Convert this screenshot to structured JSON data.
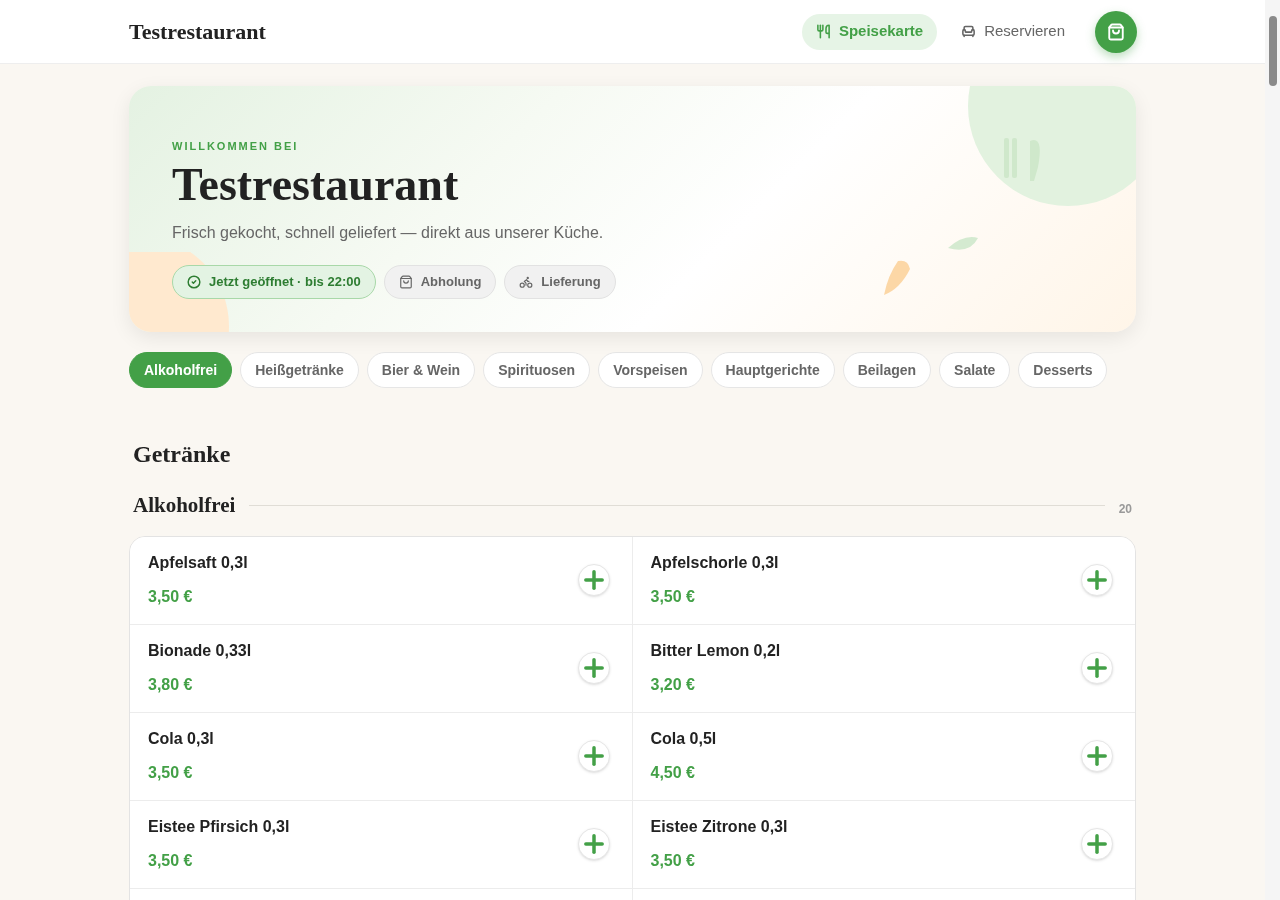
{
  "header": {
    "brand": "Testrestaurant",
    "nav": [
      {
        "label": "Speisekarte",
        "kind": "menu",
        "selected": true
      },
      {
        "label": "Reservieren",
        "kind": "reserve",
        "selected": false
      }
    ]
  },
  "hero": {
    "eyebrow": "WILLKOMMEN BEI",
    "title": "Testrestaurant",
    "subtitle": "Frisch gekocht, schnell geliefert — direkt aus unserer Küche.",
    "badges": [
      {
        "kind": "status",
        "label": "Jetzt geöffnet · bis 22:00"
      },
      {
        "kind": "pickup",
        "label": "Abholung"
      },
      {
        "kind": "delivery",
        "label": "Lieferung"
      }
    ]
  },
  "categories": [
    {
      "label": "Alkoholfrei",
      "selected": true
    },
    {
      "label": "Heißgetränke",
      "selected": false
    },
    {
      "label": "Bier & Wein",
      "selected": false
    },
    {
      "label": "Spirituosen",
      "selected": false
    },
    {
      "label": "Vorspeisen",
      "selected": false
    },
    {
      "label": "Hauptgerichte",
      "selected": false
    },
    {
      "label": "Beilagen",
      "selected": false
    },
    {
      "label": "Salate",
      "selected": false
    },
    {
      "label": "Desserts",
      "selected": false
    }
  ],
  "section": {
    "title": "Getränke",
    "subsection": "Alkoholfrei",
    "count": "20"
  },
  "items": [
    {
      "name": "Apfelsaft 0,3l",
      "price": "3,50 €"
    },
    {
      "name": "Apfelschorle 0,3l",
      "price": "3,50 €"
    },
    {
      "name": "Bionade 0,33l",
      "price": "3,80 €"
    },
    {
      "name": "Bitter Lemon 0,2l",
      "price": "3,20 €"
    },
    {
      "name": "Cola 0,3l",
      "price": "3,50 €"
    },
    {
      "name": "Cola 0,5l",
      "price": "4,50 €"
    },
    {
      "name": "Eistee Pfirsich 0,3l",
      "price": "3,50 €"
    },
    {
      "name": "Eistee Zitrone 0,3l",
      "price": "3,50 €"
    }
  ]
}
